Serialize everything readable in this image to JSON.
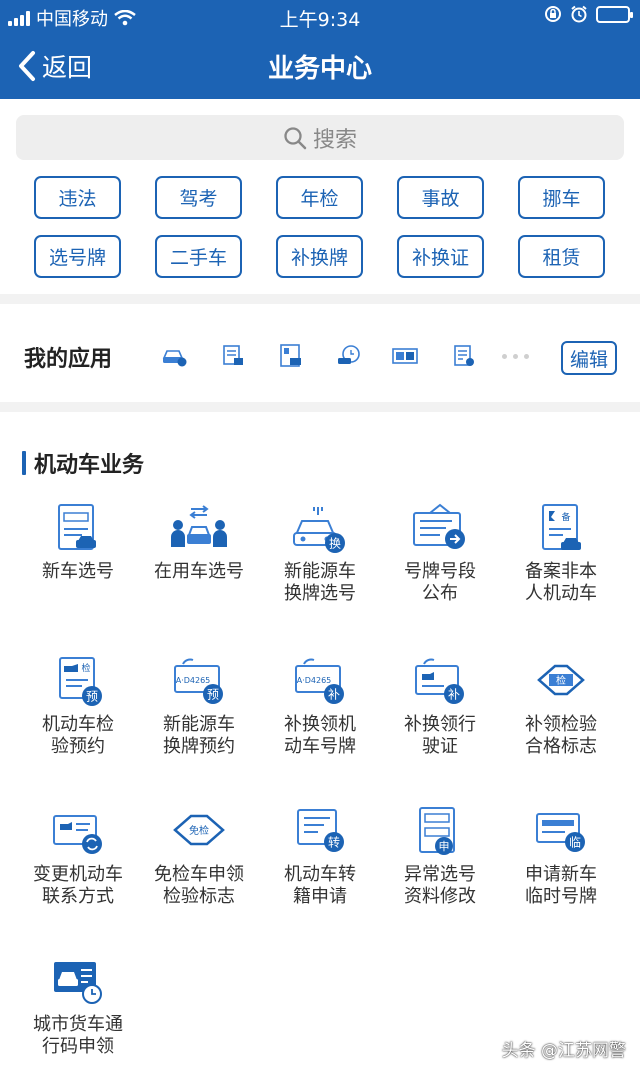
{
  "status": {
    "carrier": "中国移动",
    "time": "上午9:34"
  },
  "nav": {
    "back_label": "返回",
    "title": "业务中心"
  },
  "search": {
    "placeholder": "搜索"
  },
  "tags": [
    "违法",
    "驾考",
    "年检",
    "事故",
    "挪车",
    "选号牌",
    "二手车",
    "补换牌",
    "补换证",
    "租赁"
  ],
  "my_apps": {
    "title": "我的应用",
    "edit_label": "编辑",
    "icons": [
      "car-icon",
      "document-icon",
      "certificate-icon",
      "car-clock-icon",
      "license-plate-icon",
      "list-icon"
    ]
  },
  "section": {
    "title": "机动车业务",
    "items": [
      "新车选号",
      "在用车选号",
      "新能源车\n换牌选号",
      "号牌号段\n公布",
      "备案非本\n人机动车",
      "机动车检\n验预约",
      "新能源车\n换牌预约",
      "补换领机\n动车号牌",
      "补换领行\n驶证",
      "补领检验\n合格标志",
      "变更机动车\n联系方式",
      "免检车申领\n检验标志",
      "机动车转\n籍申请",
      "异常选号\n资料修改",
      "申请新车\n临时号牌",
      "城市货车通\n行码申领"
    ],
    "icon_badges": [
      "",
      "",
      "换",
      "",
      "备",
      "检",
      "预",
      "补",
      "补",
      "检",
      "",
      "免检",
      "转",
      "申",
      "临",
      ""
    ],
    "plate_text": [
      "A·D4265",
      "A·D4265"
    ]
  },
  "watermark": "头条 @江苏网警",
  "colors": {
    "brand": "#1c63b4",
    "accent": "#3b7fd4"
  }
}
